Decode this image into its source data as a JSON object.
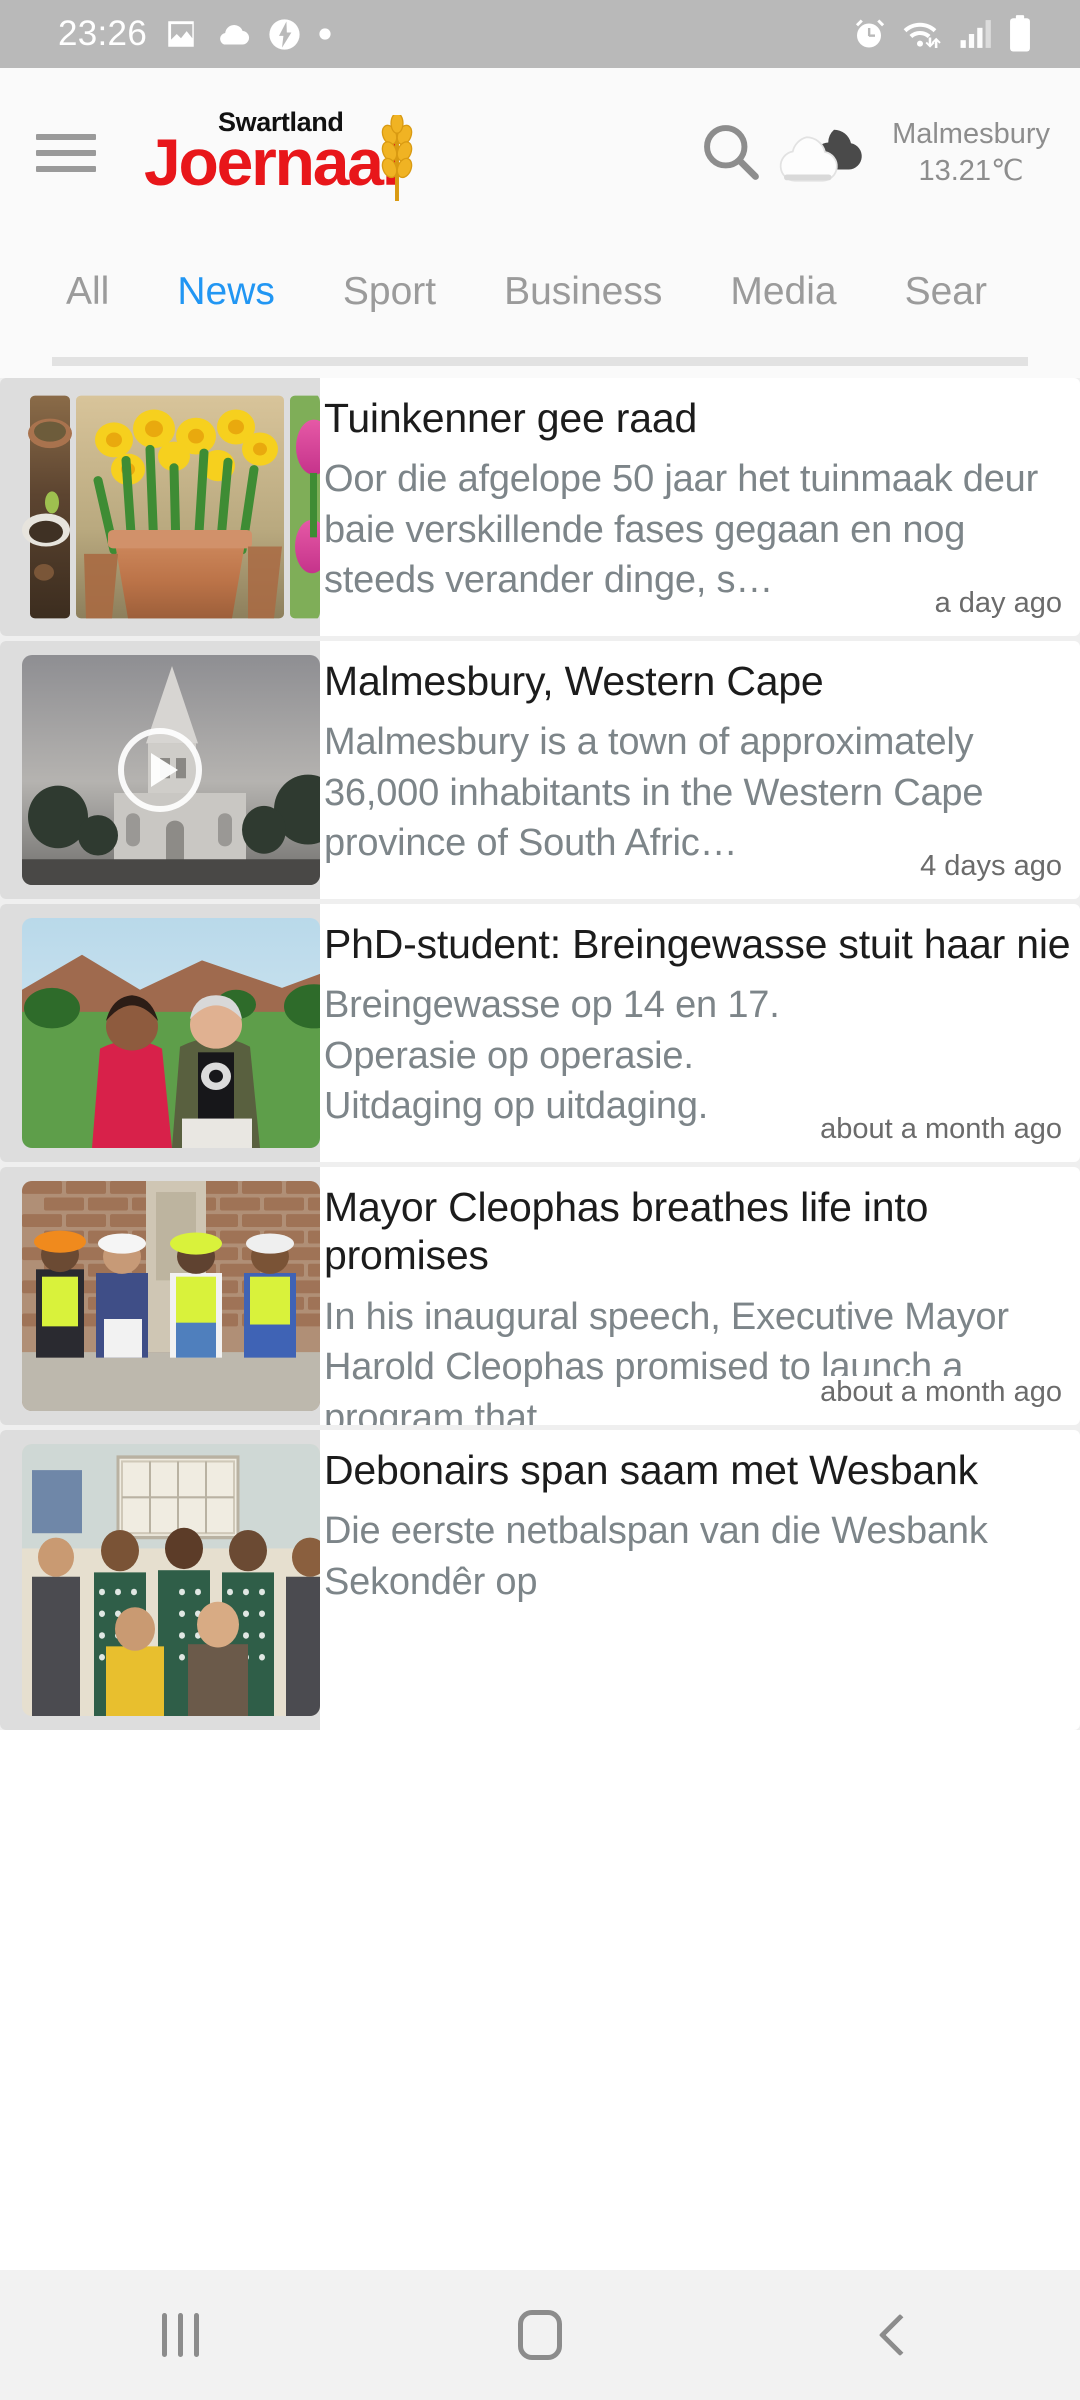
{
  "statusbar": {
    "time": "23:26",
    "left_icons": [
      "image-icon",
      "cloud-icon",
      "flash-broken-icon",
      "dot-icon"
    ],
    "right_icons": [
      "alarm-icon",
      "wifi-icon",
      "signal-icon",
      "battery-icon"
    ]
  },
  "header": {
    "menu_icon": "hamburger-icon",
    "logo_sub": "Swartland",
    "logo_main": "Joernaal",
    "search_icon": "search-icon",
    "weather": {
      "icon": "cloudy-icon",
      "location": "Malmesbury",
      "temperature": "13.21℃"
    },
    "brand_color": "#e8161a",
    "accent_color": "#2196f3"
  },
  "tabs": [
    {
      "label": "All",
      "active": false
    },
    {
      "label": "News",
      "active": true
    },
    {
      "label": "Sport",
      "active": false
    },
    {
      "label": "Business",
      "active": false
    },
    {
      "label": "Media",
      "active": false
    },
    {
      "label": "Sear",
      "active": false
    }
  ],
  "articles": [
    {
      "title": "Tuinkenner gee raad",
      "excerpt": "Oor die afgelope 50 jaar het tuinmaak deur baie verskillende fases gegaan en nog steeds verander dinge, s…",
      "time": "a day ago",
      "thumb": "garden-carousel",
      "video": false
    },
    {
      "title": "Malmesbury, Western Cape",
      "excerpt": "Malmesbury is a town of approximately 36,000 inhabitants in the Western Cape province of South Afric…",
      "time": "4 days ago",
      "thumb": "church-photo",
      "video": true
    },
    {
      "title": "PhD-student: Breingewasse stuit haar nie",
      "excerpt": "Breingewasse op 14 en 17.\nOperasie op operasie.\nUitdaging op uitdaging.",
      "time": "about a month ago",
      "thumb": "graduation-photo",
      "video": false
    },
    {
      "title": "Mayor Cleophas breathes life into promises",
      "excerpt": "In his inaugural speech, Executive Mayor Harold Cleophas promised to launch a program that …",
      "time": "about a month ago",
      "thumb": "workers-photo",
      "video": false
    },
    {
      "title": "Debonairs span saam met Wesbank",
      "excerpt": "Die eerste netbalspan van die Wesbank Sekondêr op",
      "time": "",
      "thumb": "netball-team-photo",
      "video": false
    }
  ],
  "navbar": {
    "recents_label": "recents-icon",
    "home_label": "home-icon",
    "back_label": "back-icon"
  }
}
